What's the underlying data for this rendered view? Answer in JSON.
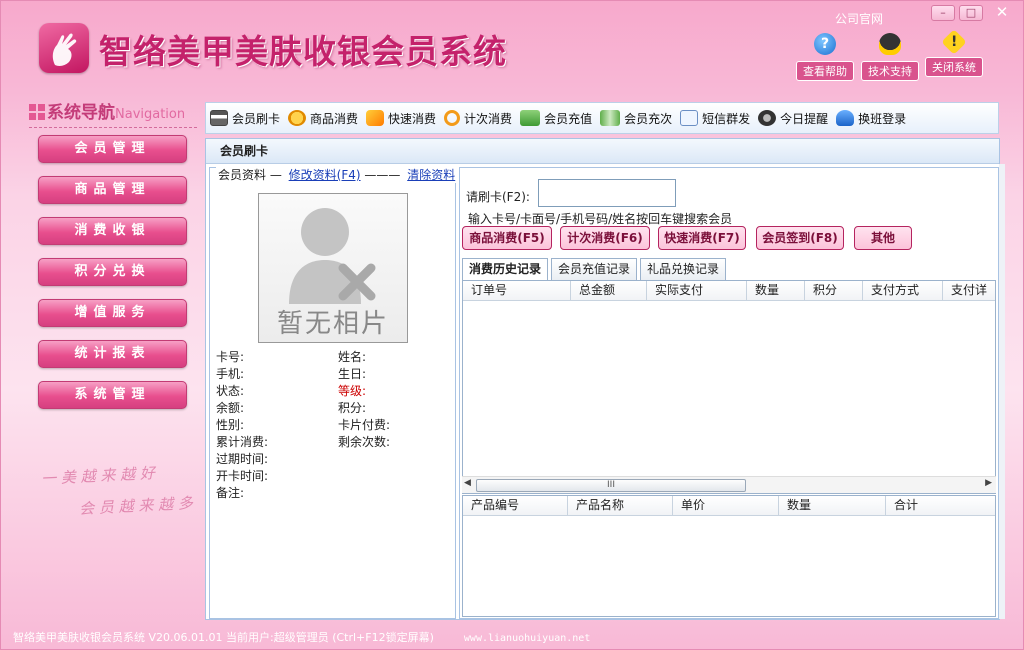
{
  "app": {
    "title": "智络美甲美肤收银会员系统",
    "official_site": "公司官网",
    "help": "查看帮助",
    "support": "技术支持",
    "close": "关闭系统"
  },
  "nav": {
    "title": "系统导航",
    "title_en": "Navigation",
    "items": [
      "会员管理",
      "商品管理",
      "消费收银",
      "积分兑换",
      "增值服务",
      "统计报表",
      "系统管理"
    ],
    "slogan_1": "一 美 越 来 越 好",
    "slogan_2": "会 员 越 来 越 多"
  },
  "toolbar": {
    "items": [
      "会员刷卡",
      "商品消费",
      "快速消费",
      "计次消费",
      "会员充值",
      "会员充次",
      "短信群发",
      "今日提醒",
      "换班登录"
    ]
  },
  "section": {
    "title": "会员刷卡"
  },
  "member": {
    "legend": "会员资料",
    "edit_link": "修改资料(F4)",
    "clear_link": "清除资料",
    "photo_caption": "暂无相片",
    "fields_left": [
      "卡号:",
      "手机:",
      "状态:",
      "余额:",
      "性别:",
      "累计消费:",
      "过期时间:",
      "开卡时间:",
      "备注:"
    ],
    "fields_right": [
      "姓名:",
      "生日:",
      "等级:",
      "积分:",
      "卡片付费:",
      "剩余次数:"
    ]
  },
  "swipe": {
    "label": "请刷卡(F2):",
    "value": "",
    "hint": "输入卡号/卡面号/手机号码/姓名按回车键搜索会员"
  },
  "actions": [
    "商品消费(F5)",
    "计次消费(F6)",
    "快速消费(F7)",
    "会员签到(F8)",
    "其他"
  ],
  "tabs": [
    "消费历史记录",
    "会员充值记录",
    "礼品兑换记录"
  ],
  "history_columns": [
    "订单号",
    "总金额",
    "实际支付",
    "数量",
    "积分",
    "支付方式",
    "支付详"
  ],
  "detail_columns": [
    "产品编号",
    "产品名称",
    "单价",
    "数量",
    "合计"
  ],
  "scroll_thumb": "III",
  "status": {
    "text": "智络美甲美肤收银会员系统 V20.06.01.01 当前用户:超级管理员 (Ctrl+F12锁定屏幕)",
    "url": "www.lianuohuiyuan.net"
  },
  "colors": {
    "accent": "#e84f8e",
    "title": "#c4226b",
    "level_label": "#cc0000"
  }
}
